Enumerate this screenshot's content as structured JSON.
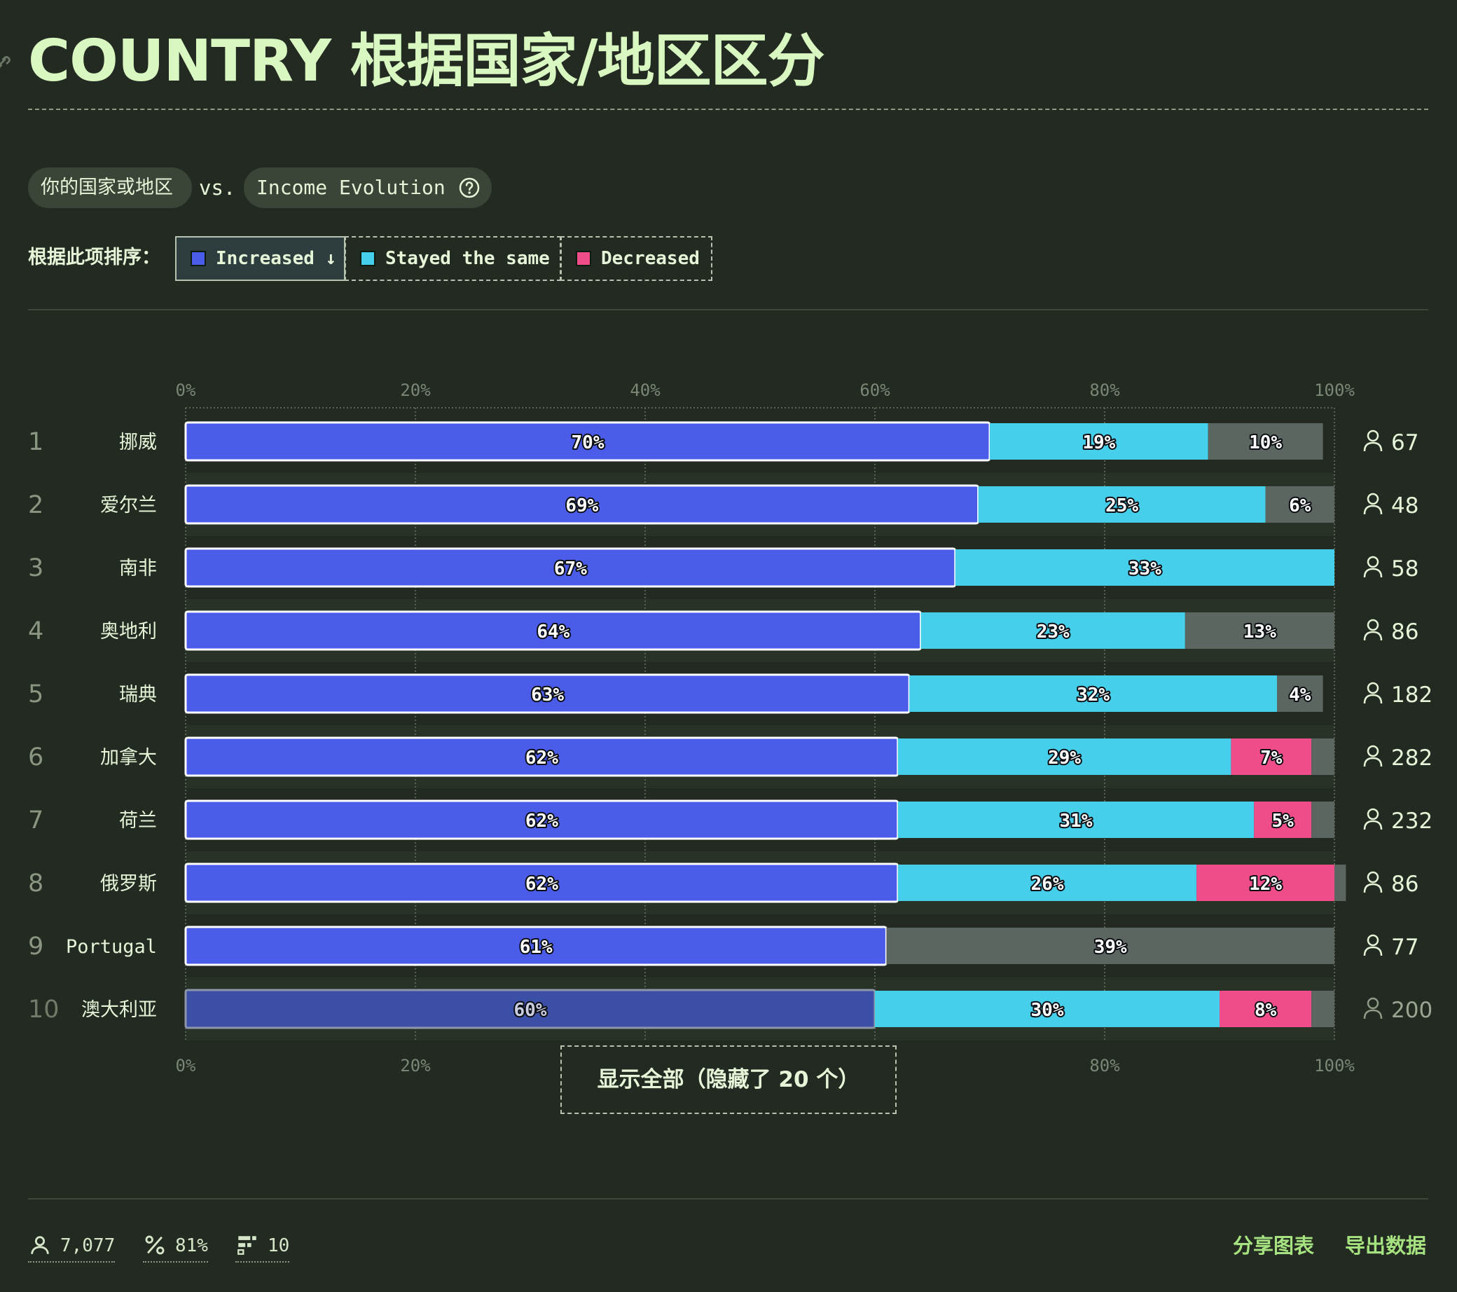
{
  "title": "COUNTRY 根据国家/地区区分",
  "filter": {
    "dimension": "你的国家或地区",
    "vs": "vs.",
    "metric": "Income Evolution"
  },
  "sort": {
    "label": "根据此项排序：",
    "options": [
      {
        "label": "Increased ↓",
        "color": "#4a5ce8",
        "active": true
      },
      {
        "label": "Stayed the same",
        "color": "#45cfea",
        "active": false
      },
      {
        "label": "Decreased",
        "color": "#ef4c8a",
        "active": false
      }
    ]
  },
  "chart_data": {
    "type": "bar",
    "orientation": "horizontal",
    "stacked": true,
    "x_ticks": [
      "0%",
      "20%",
      "40%",
      "60%",
      "80%",
      "100%"
    ],
    "xlim": [
      0,
      100
    ],
    "grid": true,
    "series_colors": {
      "increased": "#4a5ce8",
      "same": "#45cfea",
      "decreased": "#ef4c8a",
      "no_answer": "#5c6660"
    },
    "rows": [
      {
        "rank": "1",
        "country": "挪威",
        "increased": 70,
        "same": 19,
        "decreased": 0,
        "no_answer": 10,
        "respondents": "67"
      },
      {
        "rank": "2",
        "country": "爱尔兰",
        "increased": 69,
        "same": 25,
        "decreased": 0,
        "no_answer": 6,
        "respondents": "48"
      },
      {
        "rank": "3",
        "country": "南非",
        "increased": 67,
        "same": 33,
        "decreased": 0,
        "no_answer": 0,
        "respondents": "58"
      },
      {
        "rank": "4",
        "country": "奥地利",
        "increased": 64,
        "same": 23,
        "decreased": 0,
        "no_answer": 13,
        "respondents": "86"
      },
      {
        "rank": "5",
        "country": "瑞典",
        "increased": 63,
        "same": 32,
        "decreased": 0,
        "no_answer": 4,
        "respondents": "182"
      },
      {
        "rank": "6",
        "country": "加拿大",
        "increased": 62,
        "same": 29,
        "decreased": 7,
        "no_answer": 2,
        "respondents": "282"
      },
      {
        "rank": "7",
        "country": "荷兰",
        "increased": 62,
        "same": 31,
        "decreased": 5,
        "no_answer": 2,
        "respondents": "232"
      },
      {
        "rank": "8",
        "country": "俄罗斯",
        "increased": 62,
        "same": 26,
        "decreased": 12,
        "no_answer": 1,
        "respondents": "86"
      },
      {
        "rank": "9",
        "country": "Portugal",
        "increased": 61,
        "same": 0,
        "decreased": 0,
        "no_answer": 39,
        "respondents": "77"
      },
      {
        "rank": "10",
        "country": "澳大利亚",
        "increased": 60,
        "same": 30,
        "decreased": 8,
        "no_answer": 2,
        "respondents": "200"
      }
    ]
  },
  "show_all": "显示全部（隐藏了 20 个）",
  "footer": {
    "respondents": "7,077",
    "percent": "81%",
    "count": "10",
    "share": "分享图表",
    "export": "导出数据"
  }
}
